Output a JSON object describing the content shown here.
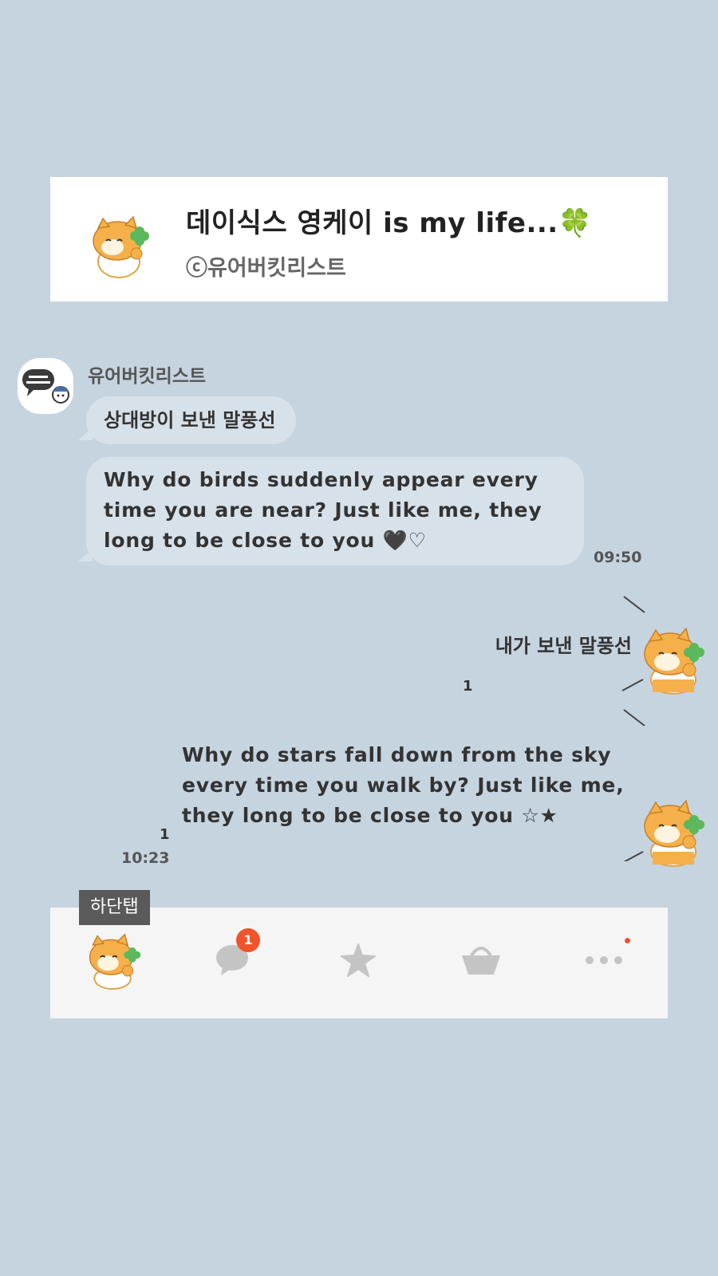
{
  "header": {
    "title": "데이식스 영케이 is my life...",
    "title_emoji": "🍀",
    "subtitle": "ⓒ유어버킷리스트",
    "avatar_icon": "hamster-clover-icon"
  },
  "incoming": {
    "sender_name": "유어버킷리스트",
    "avatar_icon": "bucketlist-logo-icon",
    "bubbles": [
      {
        "text": "상대방이 보낸 말풍선"
      },
      {
        "text": "Why do birds suddenly appear every time you are near? Just like me, they long to be close to you 🖤♡"
      }
    ],
    "time": "09:50"
  },
  "outgoing": {
    "messages": [
      {
        "text": "내가 보낸 말풍선",
        "read_count": "1"
      },
      {
        "text": "Why do stars fall down from the sky every time you walk by? Just like me, they long to be close to you ☆★",
        "read_count": "1"
      }
    ],
    "time": "10:23"
  },
  "bottom_tab": {
    "label": "하단탭",
    "tabs": [
      {
        "icon": "hamster-profile-icon"
      },
      {
        "icon": "chat-bubble-icon",
        "badge": "1"
      },
      {
        "icon": "star-icon"
      },
      {
        "icon": "basket-icon"
      },
      {
        "icon": "more-dots-icon"
      }
    ]
  },
  "colors": {
    "background": "#c6d4e0",
    "bubble": "#d7e1e9",
    "badge": "#f0542b",
    "tab_bar": "#f5f5f5"
  }
}
